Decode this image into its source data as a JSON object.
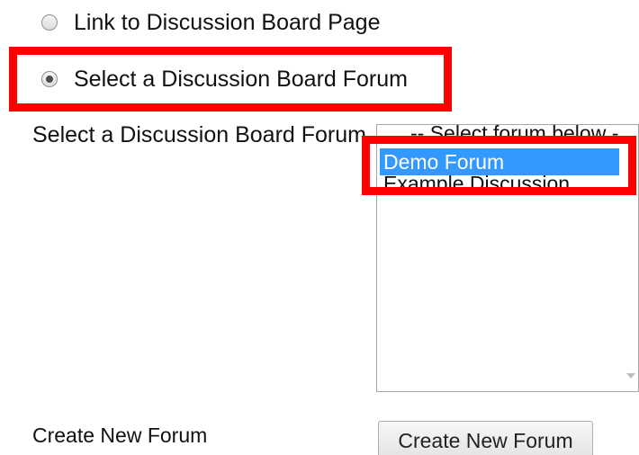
{
  "options": {
    "link_page_label": "Link to Discussion Board Page",
    "select_forum_label": "Select a Discussion Board Forum"
  },
  "forum_select": {
    "label": "Select a Discussion Board Forum",
    "placeholder_option": "-- Select forum below --",
    "items": [
      "Demo Forum",
      "Example Discussion"
    ],
    "selected": "Demo Forum"
  },
  "create_forum": {
    "label": "Create New Forum",
    "button_label": "Create New Forum"
  },
  "colors": {
    "highlight": "#ff0000",
    "selection": "#3399ff"
  }
}
